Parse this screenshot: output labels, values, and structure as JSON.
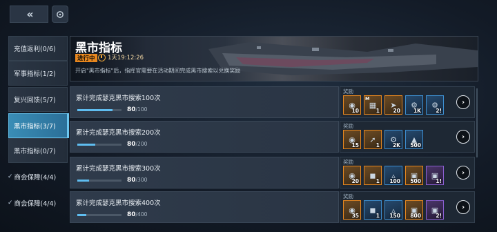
{
  "nav": {
    "back_icon": "chevron-double-left",
    "refresh_icon": "refresh"
  },
  "sidebar": {
    "items": [
      {
        "label": "充值返利(0/6)",
        "checked": false,
        "active": false
      },
      {
        "label": "军事指标(1/2)",
        "checked": false,
        "active": false
      },
      {
        "label": "复兴回馈(5/7)",
        "checked": false,
        "active": false
      },
      {
        "label": "黑市指标(3/7)",
        "checked": false,
        "active": true
      },
      {
        "label": "黑市指标(0/7)",
        "checked": false,
        "active": false
      },
      {
        "label": "商会保障(4/4)",
        "checked": true,
        "active": false
      },
      {
        "label": "商会保障(4/4)",
        "checked": true,
        "active": false
      }
    ]
  },
  "banner": {
    "title": "黑市指标",
    "status": "进行中",
    "timer": "1天19:12:26",
    "description": "开启\"黑市指标\"后，指挥官需要在活动期间完成黑市搜索以兑换奖励"
  },
  "reward_label": "奖励",
  "tasks": [
    {
      "title": "累计完成瑟克黑市搜索100次",
      "progress": 80,
      "total": "/100",
      "fraction": 0.8,
      "rewards": [
        {
          "icon": "helmet-icon",
          "count": "10",
          "rarity": "orange",
          "tag": ""
        },
        {
          "icon": "module-icon",
          "count": "1",
          "rarity": "orange",
          "tag": "M"
        },
        {
          "icon": "engine-icon",
          "count": "20",
          "rarity": "orange",
          "tag": ""
        },
        {
          "icon": "gear-icon",
          "count": "1K",
          "rarity": "blue",
          "tag": ""
        },
        {
          "icon": "gear-icon",
          "count": "2!",
          "rarity": "blue",
          "tag": ""
        }
      ]
    },
    {
      "title": "累计完成瑟克黑市搜索200次",
      "progress": 80,
      "total": "/200",
      "fraction": 0.4,
      "rewards": [
        {
          "icon": "helmet-icon",
          "count": "15",
          "rarity": "orange",
          "tag": ""
        },
        {
          "icon": "missile-icon",
          "count": "1",
          "rarity": "orange",
          "tag": ""
        },
        {
          "icon": "gear-icon",
          "count": "2K",
          "rarity": "blue",
          "tag": ""
        },
        {
          "icon": "ore-icon",
          "count": "500",
          "rarity": "blue",
          "tag": ""
        }
      ]
    },
    {
      "title": "累计完成瑟克黑市搜索300次",
      "progress": 80,
      "total": "/300",
      "fraction": 0.27,
      "rewards": [
        {
          "icon": "helmet-icon",
          "count": "20",
          "rarity": "orange",
          "tag": ""
        },
        {
          "icon": "armor-icon",
          "count": "1",
          "rarity": "orange",
          "tag": ""
        },
        {
          "icon": "ship-icon",
          "count": "100",
          "rarity": "blue",
          "tag": ""
        },
        {
          "icon": "chest-icon",
          "count": "500",
          "rarity": "orange",
          "tag": ""
        },
        {
          "icon": "chest-icon",
          "count": "1!",
          "rarity": "purple",
          "tag": ""
        }
      ]
    },
    {
      "title": "累计完成瑟克黑市搜索400次",
      "progress": 80,
      "total": "/400",
      "fraction": 0.2,
      "rewards": [
        {
          "icon": "helmet-icon",
          "count": "35",
          "rarity": "orange",
          "tag": ""
        },
        {
          "icon": "armor-icon",
          "count": "1",
          "rarity": "blue",
          "tag": ""
        },
        {
          "icon": "ship-icon",
          "count": "150",
          "rarity": "blue",
          "tag": ""
        },
        {
          "icon": "chest-icon",
          "count": "800",
          "rarity": "orange",
          "tag": ""
        },
        {
          "icon": "chest-icon",
          "count": "2!",
          "rarity": "purple",
          "tag": ""
        }
      ]
    }
  ]
}
